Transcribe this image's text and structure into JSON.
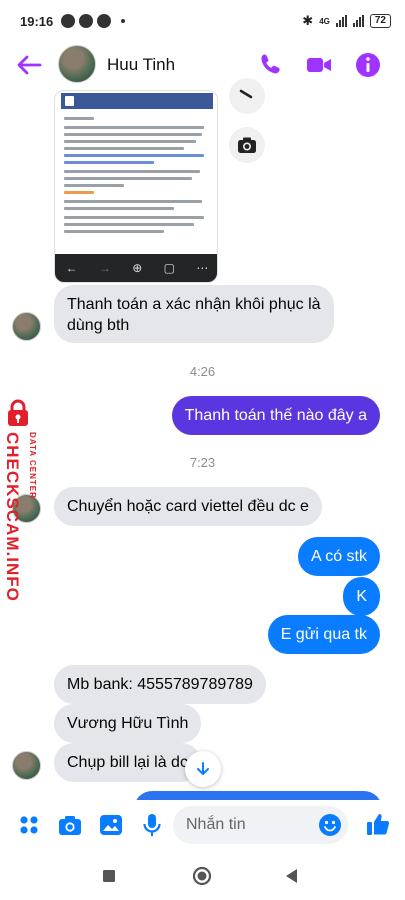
{
  "status_bar": {
    "time": "19:16",
    "network": "4G",
    "battery": "72"
  },
  "header": {
    "contact_name": "Huu Tinh",
    "icons": [
      "back-arrow-icon",
      "phone-icon",
      "video-icon",
      "info-icon"
    ],
    "accent_color": "#a033ff"
  },
  "messages": [
    {
      "side": "in",
      "text": "Thanh toán a xác nhận khôi phục là\ndùng bth"
    },
    {
      "type": "timestamp",
      "text": "4:26"
    },
    {
      "side": "out",
      "text": "Thanh toán thế nào đây a"
    },
    {
      "type": "timestamp",
      "text": "7:23"
    },
    {
      "side": "in",
      "text": "Chuyển hoặc card viettel đều dc e"
    },
    {
      "side": "out",
      "text": "A có stk"
    },
    {
      "side": "out",
      "text": "K"
    },
    {
      "side": "out",
      "text": "E gửi qua tk"
    },
    {
      "side": "in",
      "text": "Mb bank: 4555789789789"
    },
    {
      "side": "in",
      "text": "Vương Hữu Tình"
    },
    {
      "side": "in",
      "text": "Chụp bill lại là dc"
    }
  ],
  "watermark": {
    "main": "CHECKSCAM.INFO",
    "sub": "DATA CENTER"
  },
  "composer": {
    "placeholder": "Nhắn tin",
    "icons": [
      "apps-icon",
      "camera-icon",
      "gallery-icon",
      "microphone-icon",
      "emoji-icon",
      "thumbs-up-icon"
    ]
  },
  "colors": {
    "incoming_bubble": "#e4e6eb",
    "outgoing_bubble": "#0a7cff",
    "outgoing_bubble_alt": "#5a36e0",
    "watermark": "#e0202a"
  }
}
